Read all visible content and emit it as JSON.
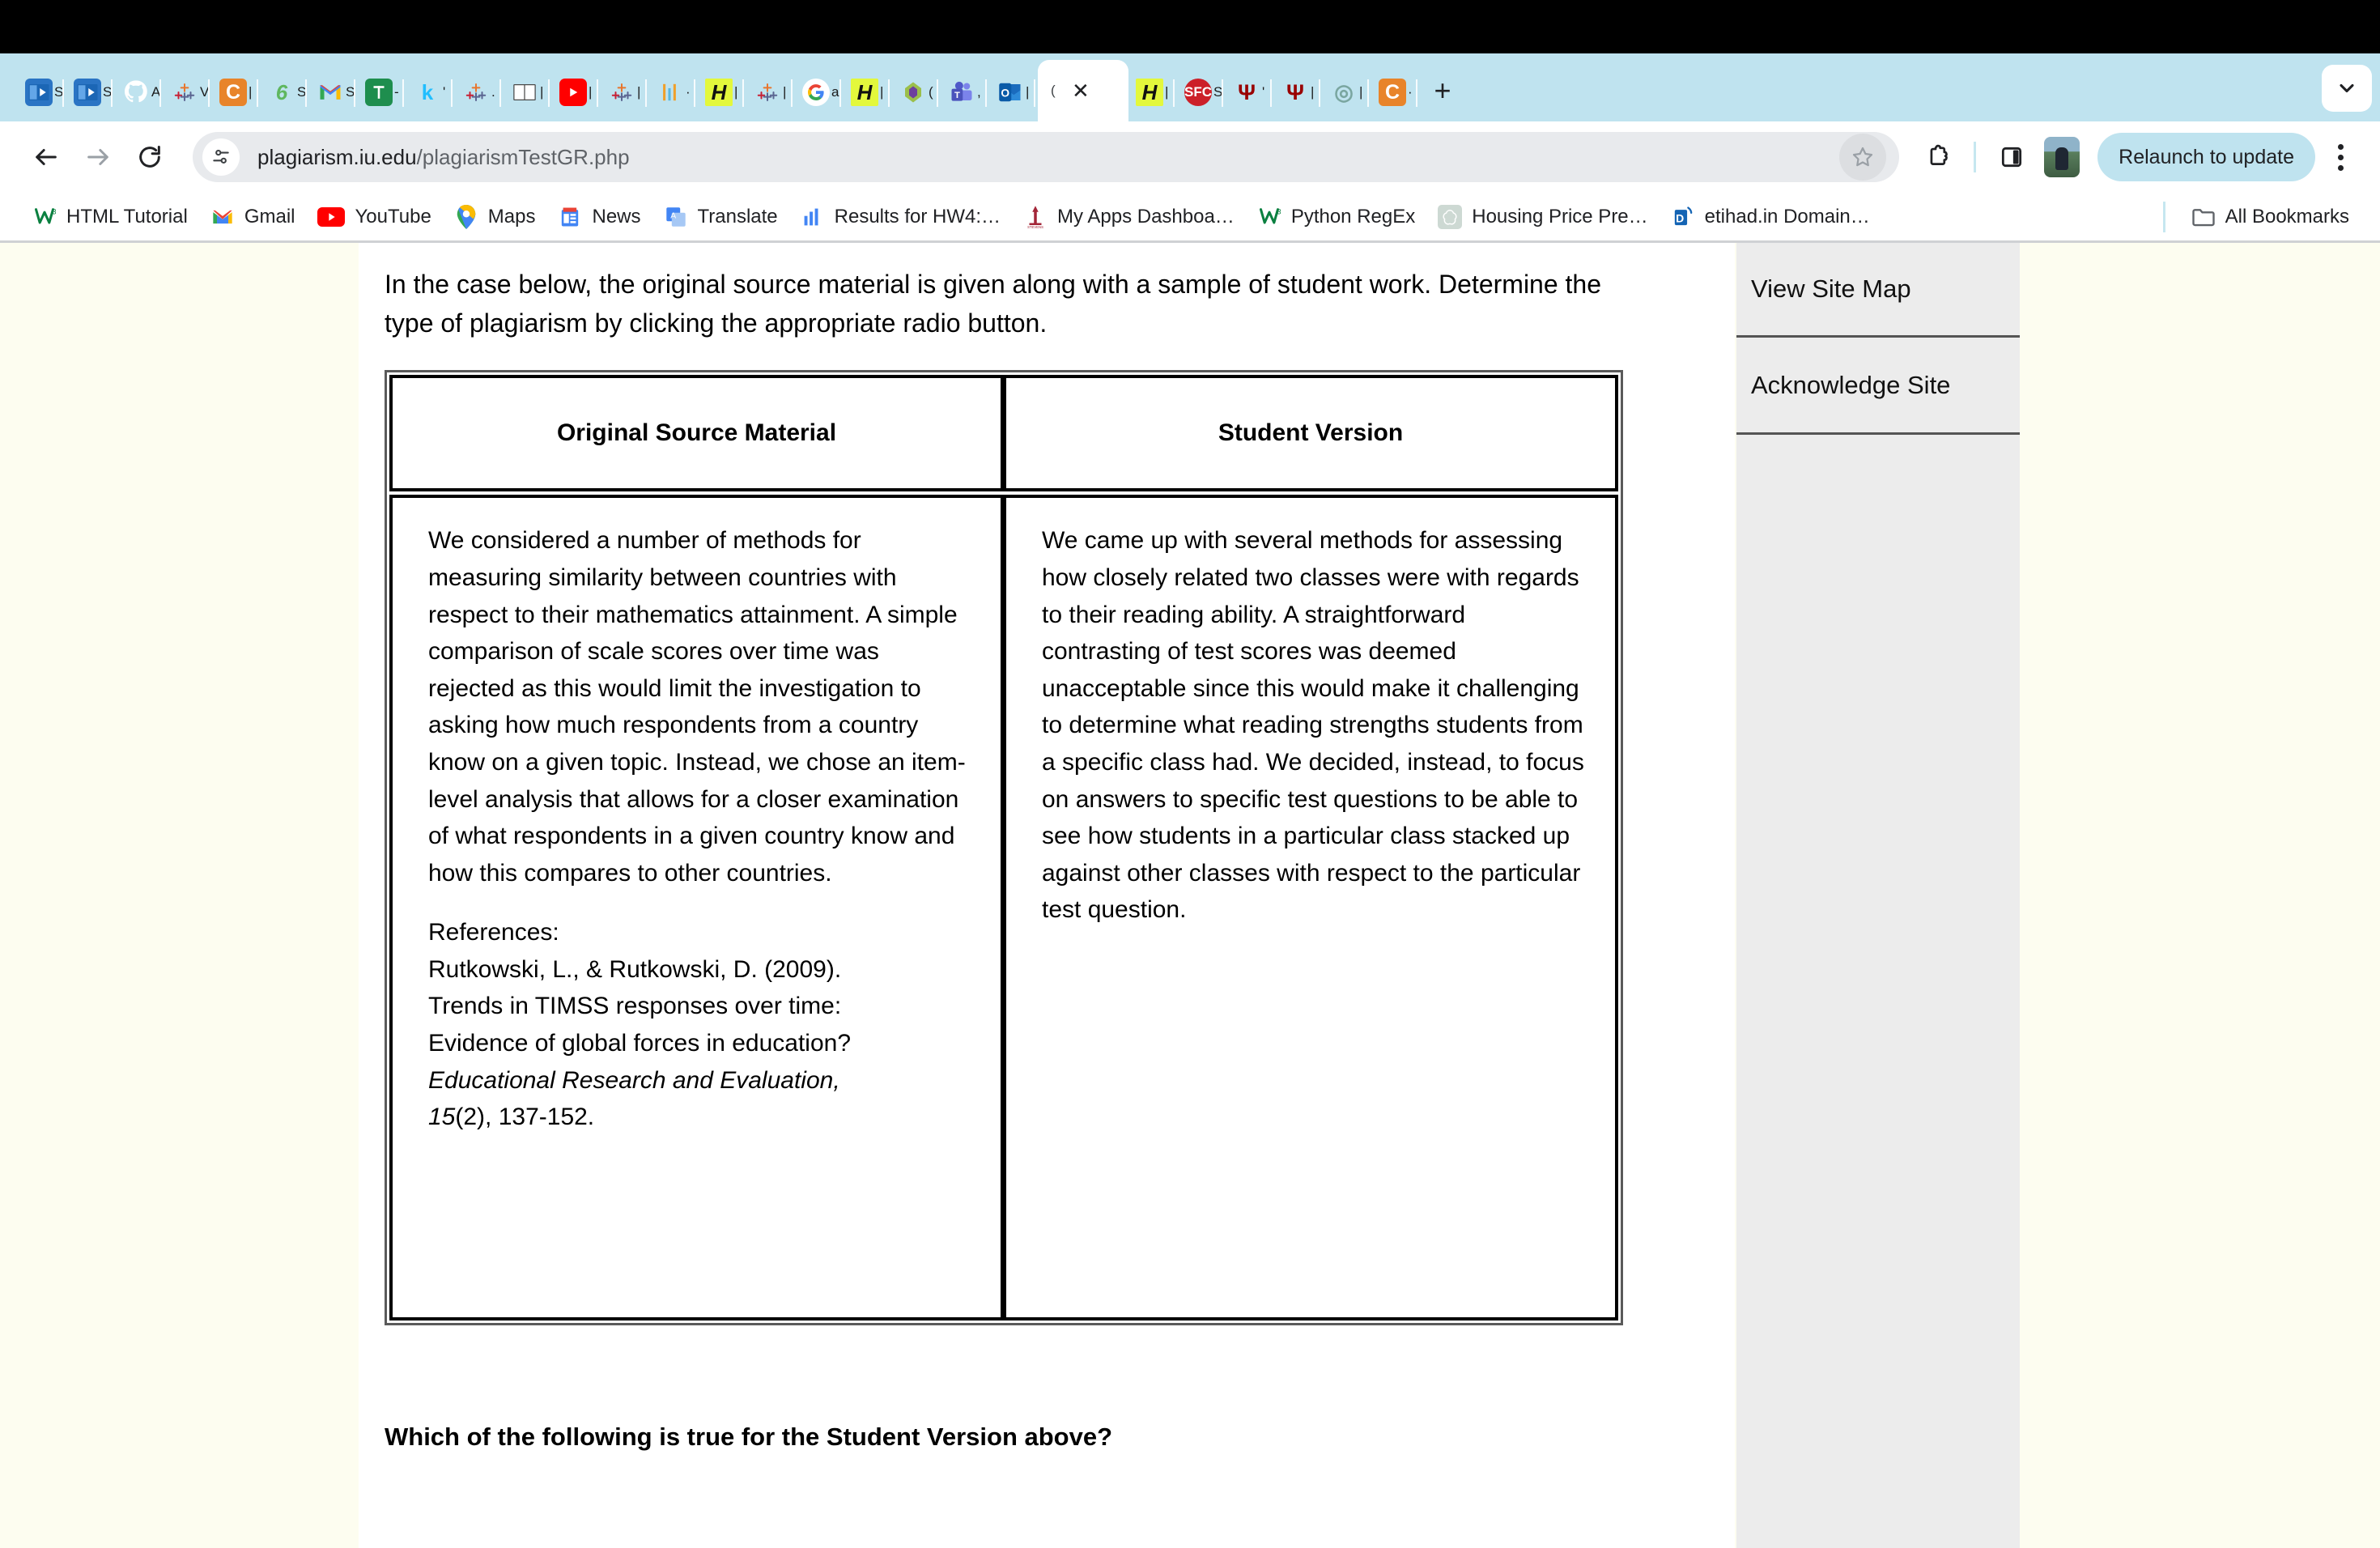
{
  "browser": {
    "omnibox": {
      "url_bold": "plagiarism.iu.edu",
      "url_dim": "/plagiarismTestGR.php",
      "site_info_icon": "site-settings-icon"
    },
    "relaunch_label": "Relaunch to update",
    "new_tab_label": "+",
    "tabs": [
      {
        "favicon": "video-player-icon",
        "title": ""
      },
      {
        "favicon": "video-player-icon",
        "title": ""
      },
      {
        "favicon": "github-icon",
        "title": ""
      },
      {
        "favicon": "tableau-icon",
        "title": ""
      },
      {
        "favicon": "coursera-icon",
        "title": ""
      },
      {
        "favicon": "leaf-icon",
        "title": ""
      },
      {
        "favicon": "gmail-icon",
        "title": ""
      },
      {
        "favicon": "sheets-icon",
        "title": ""
      },
      {
        "favicon": "kaggle-icon",
        "title": ""
      },
      {
        "favicon": "tableau-icon",
        "title": ""
      },
      {
        "favicon": "book-icon",
        "title": ""
      },
      {
        "favicon": "youtube-icon",
        "title": ""
      },
      {
        "favicon": "tableau-icon",
        "title": ""
      },
      {
        "favicon": "chart-icon",
        "title": ""
      },
      {
        "favicon": "highlight-h-icon",
        "title": ""
      },
      {
        "favicon": "tableau-icon",
        "title": ""
      },
      {
        "favicon": "google-icon",
        "title": ""
      },
      {
        "favicon": "highlight-h-icon",
        "title": ""
      },
      {
        "favicon": "gem-icon",
        "title": ""
      },
      {
        "favicon": "teams-icon",
        "title": ""
      },
      {
        "favicon": "outlook-icon",
        "title": ""
      },
      {
        "favicon": "plagiarism-icon",
        "title": "",
        "active": true
      },
      {
        "favicon": "highlight-h-icon",
        "title": ""
      },
      {
        "favicon": "sfc-icon",
        "title": ""
      },
      {
        "favicon": "indiana-university-icon",
        "title": ""
      },
      {
        "favicon": "indiana-university-icon",
        "title": ""
      },
      {
        "favicon": "spiral-icon",
        "title": ""
      },
      {
        "favicon": "coursera-icon",
        "title": ""
      }
    ],
    "toolbar_icons": {
      "back": "back-arrow-icon",
      "forward": "forward-arrow-icon",
      "reload": "reload-icon",
      "bookmark_star": "star-icon",
      "extensions": "extensions-puzzle-icon",
      "side_panel": "side-panel-icon",
      "profile": "profile-avatar"
    },
    "bookmarks": [
      {
        "label": "HTML Tutorial",
        "icon": "w3schools-icon"
      },
      {
        "label": "Gmail",
        "icon": "gmail-icon"
      },
      {
        "label": "YouTube",
        "icon": "youtube-icon"
      },
      {
        "label": "Maps",
        "icon": "google-maps-icon"
      },
      {
        "label": "News",
        "icon": "google-news-icon"
      },
      {
        "label": "Translate",
        "icon": "google-translate-icon"
      },
      {
        "label": "Results for HW4:…",
        "icon": "bar-chart-icon"
      },
      {
        "label": "My Apps Dashboa…",
        "icon": "stevens-icon"
      },
      {
        "label": "Python RegEx",
        "icon": "w3schools-icon"
      },
      {
        "label": "Housing Price Pre…",
        "icon": "openai-icon"
      },
      {
        "label": "etihad.in Domain…",
        "icon": "dan-icon"
      }
    ],
    "all_bookmarks_label": "All Bookmarks",
    "all_bookmarks_icon": "folder-icon"
  },
  "page": {
    "intro": "In the case below, the original source material is given along with a sample of student work. Determine the type of plagiarism by clicking the appropriate radio button.",
    "table": {
      "headers": [
        "Original Source Material",
        "Student Version"
      ],
      "original": {
        "body": "We considered a number of methods for measuring similarity between countries with respect to their mathematics attainment. A simple comparison of scale scores over time was rejected as this would limit the investigation to asking how much respondents from a country know on a given topic. Instead, we chose an item-level analysis that allows for a closer examination of what respondents in a given country know and how this compares to other countries.",
        "references_label": "References:",
        "reference_line1": "Rutkowski, L., & Rutkowski, D. (2009).",
        "reference_line2": "Trends in TIMSS responses over time:",
        "reference_line3": "Evidence of global forces in education?",
        "reference_journal": "Educational Research and Evaluation,",
        "reference_volume": "15",
        "reference_tail": "(2), 137-152."
      },
      "student": {
        "body": "We came up with several methods for assessing how closely related two classes were with regards to their reading ability. A straightforward contrasting of test scores was deemed unacceptable since this would make it challenging to determine what reading strengths students from a specific class had. We decided, instead, to focus on answers to specific test questions to be able to see how students in a particular class stacked up against other classes with respect to the particular test question."
      }
    },
    "question": "Which of the following is true for the Student Version above?",
    "sidebar": {
      "items": [
        {
          "label": "View Site Map"
        },
        {
          "label": "Acknowledge Site"
        }
      ]
    }
  },
  "colors": {
    "tab_strip": "#bfe3ef",
    "page_margin": "#fdfdf0",
    "sidebar_bg": "#ececec",
    "accent": "#bfe3ef"
  }
}
